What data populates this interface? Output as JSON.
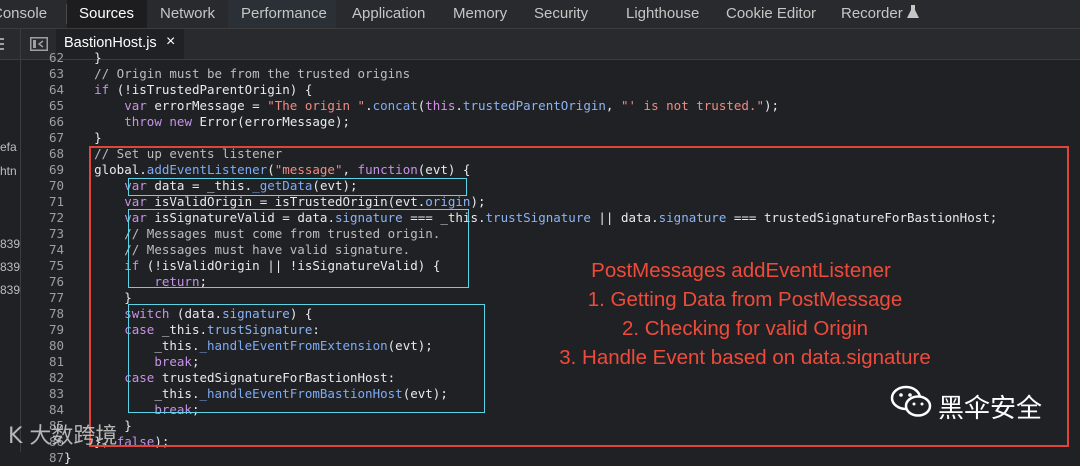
{
  "tabs": [
    "Console",
    "Sources",
    "Network",
    "Performance",
    "Application",
    "Memory",
    "Security",
    "Lighthouse",
    "Cookie Editor",
    "Recorder"
  ],
  "file": {
    "name": "BastionHost.js",
    "close": "×"
  },
  "left_pane": [
    "efa",
    "htn",
    "839",
    "839",
    "839"
  ],
  "code": [
    {
      "n": "62",
      "t": "    }"
    },
    {
      "n": "63",
      "t": "    // Origin must be from the trusted origins"
    },
    {
      "n": "64",
      "t": "    if (!isTrustedParentOrigin) {"
    },
    {
      "n": "65",
      "t": "        var errorMessage = \"The origin \".concat(this.trustedParentOrigin, \"' is not trusted.\");"
    },
    {
      "n": "66",
      "t": "        throw new Error(errorMessage);"
    },
    {
      "n": "67",
      "t": "    }"
    },
    {
      "n": "68",
      "t": "    // Set up events listener"
    },
    {
      "n": "69",
      "t": "    global.addEventListener(\"message\", function(evt) {"
    },
    {
      "n": "70",
      "t": "        var data = _this._getData(evt);"
    },
    {
      "n": "71",
      "t": "        var isValidOrigin = isTrustedOrigin(evt.origin);"
    },
    {
      "n": "72",
      "t": "        var isSignatureValid = data.signature === _this.trustSignature || data.signature === trustedSignatureForBastionHost;"
    },
    {
      "n": "73",
      "t": "        // Messages must come from trusted origin."
    },
    {
      "n": "74",
      "t": "        // Messages must have valid signature."
    },
    {
      "n": "75",
      "t": "        if (!isValidOrigin || !isSignatureValid) {"
    },
    {
      "n": "76",
      "t": "            return;"
    },
    {
      "n": "77",
      "t": "        }"
    },
    {
      "n": "78",
      "t": "        switch (data.signature) {"
    },
    {
      "n": "79",
      "t": "        case _this.trustSignature:"
    },
    {
      "n": "80",
      "t": "            _this._handleEventFromExtension(evt);"
    },
    {
      "n": "81",
      "t": "            break;"
    },
    {
      "n": "82",
      "t": "        case trustedSignatureForBastionHost:"
    },
    {
      "n": "83",
      "t": "            _this._handleEventFromBastionHost(evt);"
    },
    {
      "n": "84",
      "t": "            break;"
    },
    {
      "n": "85",
      "t": "        }"
    },
    {
      "n": "86",
      "t": "    }, false);"
    },
    {
      "n": "87",
      "t": "}"
    }
  ],
  "annotation": [
    "PostMessages addEventListener",
    "1. Getting Data from PostMessage",
    "2. Checking for valid Origin",
    "3. Handle Event based on data.signature"
  ],
  "watermark": "黑伞安全",
  "watermark2": "K 大数跨境",
  "colors": {
    "red_box": "#e0453a",
    "cyan_box": "#5fd3e6"
  }
}
